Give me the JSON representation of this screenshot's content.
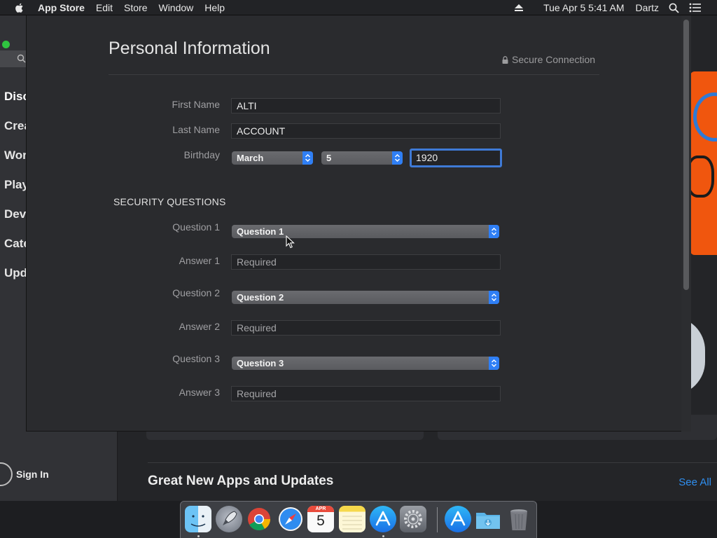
{
  "menubar": {
    "app_name": "App Store",
    "menus": [
      "Edit",
      "Store",
      "Window",
      "Help"
    ],
    "date_time": "Tue Apr 5  5:41 AM",
    "user": "Dartz"
  },
  "background": {
    "nav_items": [
      "Disc",
      "Crea",
      "Wor",
      "Play",
      "Dev",
      "Cate",
      "Upd"
    ],
    "sign_in": "Sign In",
    "section_title": "Great New Apps and Updates",
    "see_all": "See All"
  },
  "sheet": {
    "title": "Personal Information",
    "secure_label": "Secure Connection",
    "first_name": {
      "label": "First Name",
      "value": "ALTI"
    },
    "last_name": {
      "label": "Last Name",
      "value": "ACCOUNT"
    },
    "birthday": {
      "label": "Birthday",
      "month": "March",
      "day": "5",
      "year": "1920"
    },
    "security_heading": "SECURITY QUESTIONS",
    "questions": [
      {
        "q_label": "Question 1",
        "q_value": "Question 1",
        "a_label": "Answer 1",
        "a_placeholder": "Required"
      },
      {
        "q_label": "Question 2",
        "q_value": "Question 2",
        "a_label": "Answer 2",
        "a_placeholder": "Required"
      },
      {
        "q_label": "Question 3",
        "q_value": "Question 3",
        "a_label": "Answer 3",
        "a_placeholder": "Required"
      }
    ]
  },
  "colors": {
    "accent_blue": "#2f7ff5",
    "focus_ring": "#3f7ad6",
    "link_blue": "#2f8ff0",
    "traffic_green": "#2fc440"
  },
  "dock": {
    "apps": [
      "finder-icon",
      "launchpad-icon",
      "chrome-icon",
      "safari-icon",
      "calendar-icon",
      "notes-icon",
      "app-store-icon",
      "system-preferences-icon",
      "app-store-downloads-icon",
      "downloads-folder-icon",
      "trash-icon"
    ],
    "calendar_month": "APR",
    "calendar_day": "5"
  }
}
